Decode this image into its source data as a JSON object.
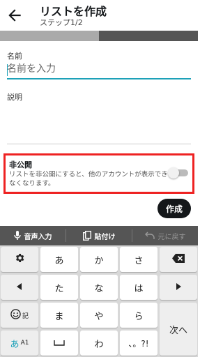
{
  "header": {
    "title": "リストを作成",
    "subtitle": "ステップ1/2"
  },
  "progress": {
    "fraction": 0.5
  },
  "form": {
    "name_label": "名前",
    "name_placeholder": "名前を入力",
    "name_value": "",
    "description_label": "説明",
    "private_title": "非公開",
    "private_description": "リストを非公開にすると、他のアカウントが表示できなくなります。",
    "private_enabled": false
  },
  "actions": {
    "create_label": "作成"
  },
  "keyboard": {
    "toolbar": {
      "voice_label": "音声入力",
      "paste_label": "貼付け",
      "undo_label": "元に戻す"
    },
    "keys": {
      "a": "あ",
      "ka": "か",
      "sa": "さ",
      "ta": "た",
      "na": "な",
      "ha": "は",
      "ma": "ま",
      "ya": "や",
      "ra": "ら",
      "wa": "わ",
      "punct": "、。?!",
      "symbol_label": "記",
      "mode_main": "あ",
      "mode_sub": "A1",
      "next_label": "次へ"
    }
  },
  "colors": {
    "accent": "#1da1b8",
    "highlight_border": "#ee2222",
    "button": "#14171a"
  }
}
